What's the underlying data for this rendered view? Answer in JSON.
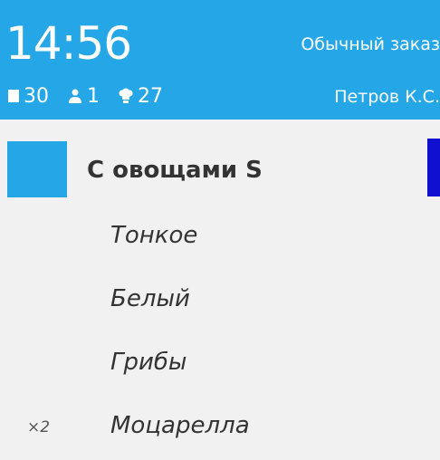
{
  "header": {
    "time": "14:56",
    "order_type": "Обычный заказ",
    "waiter": "Петров К.С.",
    "stats": {
      "table": "30",
      "guests": "1",
      "order_number": "27"
    },
    "icons": {
      "table": "table-icon",
      "guests": "person-icon",
      "order": "chef-hat-icon"
    }
  },
  "item": {
    "name": "С овощами S",
    "modifiers": [
      {
        "qty": "",
        "name": "Тонкое"
      },
      {
        "qty": "",
        "name": "Белый"
      },
      {
        "qty": "",
        "name": "Грибы"
      },
      {
        "qty": "×2",
        "name": "Моцарелла"
      }
    ]
  },
  "colors": {
    "accent": "#25a7e7",
    "scroll_indicator": "#1010d0",
    "background": "#f1f1f1",
    "text": "#333333"
  }
}
